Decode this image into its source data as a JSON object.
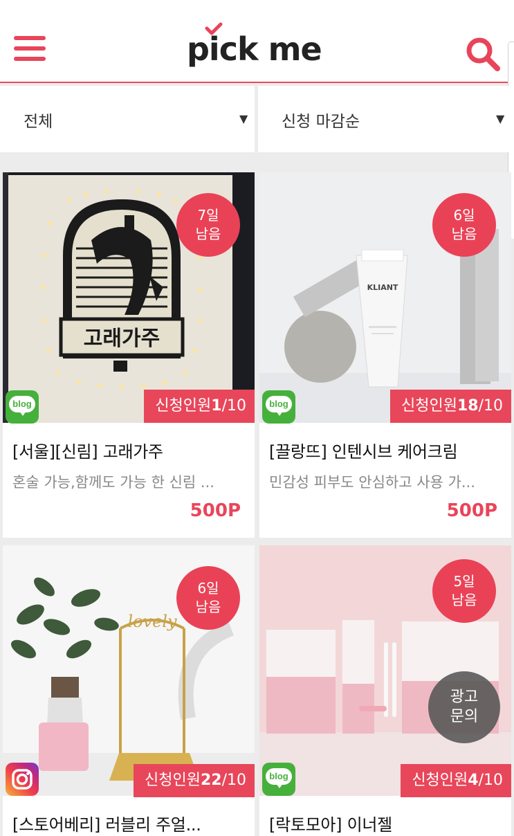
{
  "header": {
    "logo": "pick me"
  },
  "filters": {
    "category": "전체",
    "sort": "신청 마감순",
    "caret": "▼"
  },
  "cards": [
    {
      "days_line1": "7일",
      "days_line2": "남음",
      "sns": "blog",
      "applicants_label": "신청인원",
      "applicants_current": "1",
      "applicants_total": "/10",
      "title": "[서울][신림] 고래가주",
      "description": "혼술 가능,함께도 가능 한 신림 ...",
      "points": "500P",
      "sign_text": "고래가주"
    },
    {
      "days_line1": "6일",
      "days_line2": "남음",
      "sns": "blog",
      "applicants_label": "신청인원",
      "applicants_current": "18",
      "applicants_total": "/10",
      "title": "[끌랑뜨] 인텐시브 케어크림",
      "description": "민감성 피부도 안심하고 사용 가...",
      "points": "500P",
      "product_brand": "KLIANT"
    },
    {
      "days_line1": "6일",
      "days_line2": "남음",
      "sns": "instagram",
      "applicants_label": "신청인원",
      "applicants_current": "22",
      "applicants_total": "/10",
      "title": "[스토어베리] 러블리 주얼...",
      "sign_text": "lovely"
    },
    {
      "days_line1": "5일",
      "days_line2": "남음",
      "sns": "blog",
      "applicants_label": "신청인원",
      "applicants_current": "4",
      "applicants_total": "/10",
      "title": "[락토모아] 이너젤"
    }
  ],
  "ad_button": {
    "line1": "광고",
    "line2": "문의"
  },
  "blog_badge_text": "blog",
  "colors": {
    "accent": "#e9455a",
    "blog_green": "#46b03c",
    "background": "#ececec"
  }
}
